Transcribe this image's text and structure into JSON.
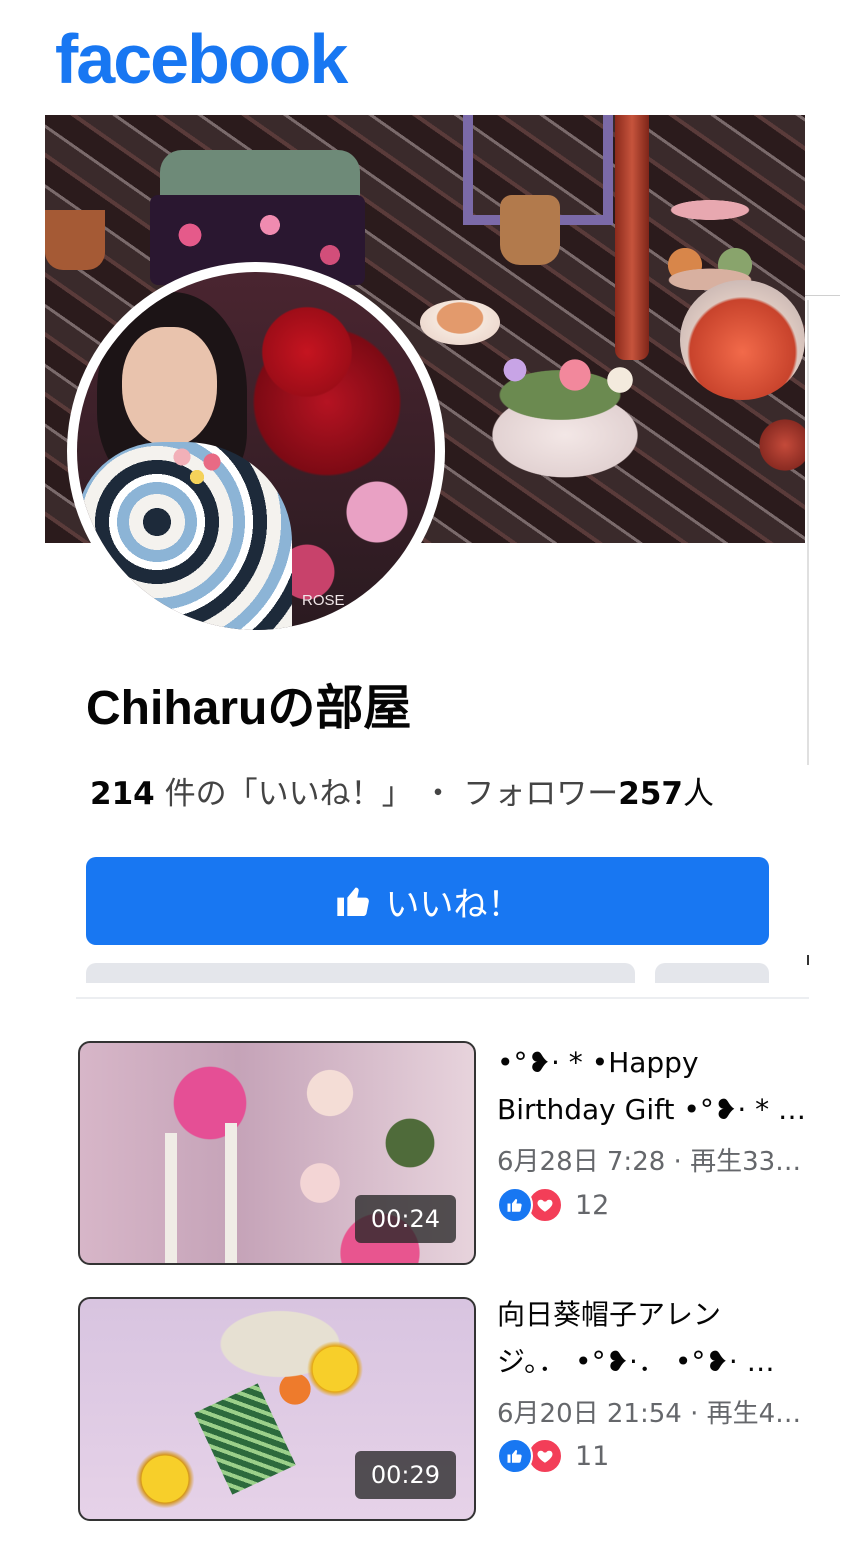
{
  "logo": "facebook",
  "profile": {
    "avatar_caption": "ROSE",
    "name": "Chiharuの部屋",
    "likes_count": "214",
    "likes_label": " 件の「いいね！」",
    "separator": "・",
    "followers_label": "フォロワー",
    "followers_count": "257",
    "followers_unit": "人"
  },
  "like_button": {
    "label": "いいね！",
    "icon": "thumbs-up-icon"
  },
  "videos": [
    {
      "title_line1": "•°❥· * •Happy",
      "title_line2": "Birthday Gift •°❥· * …",
      "meta": "6月28日 7:28 · 再生33…",
      "duration": "00:24",
      "reaction_count": "12"
    },
    {
      "title_line1": "向日葵帽子アレン",
      "title_line2": "ジ。． •°❥·． •°❥· …",
      "meta": "6月20日 21:54 · 再生4…",
      "duration": "00:29",
      "reaction_count": "11"
    }
  ],
  "colors": {
    "brand": "#1877f2",
    "love": "#f33e58",
    "muted": "#65676b"
  }
}
